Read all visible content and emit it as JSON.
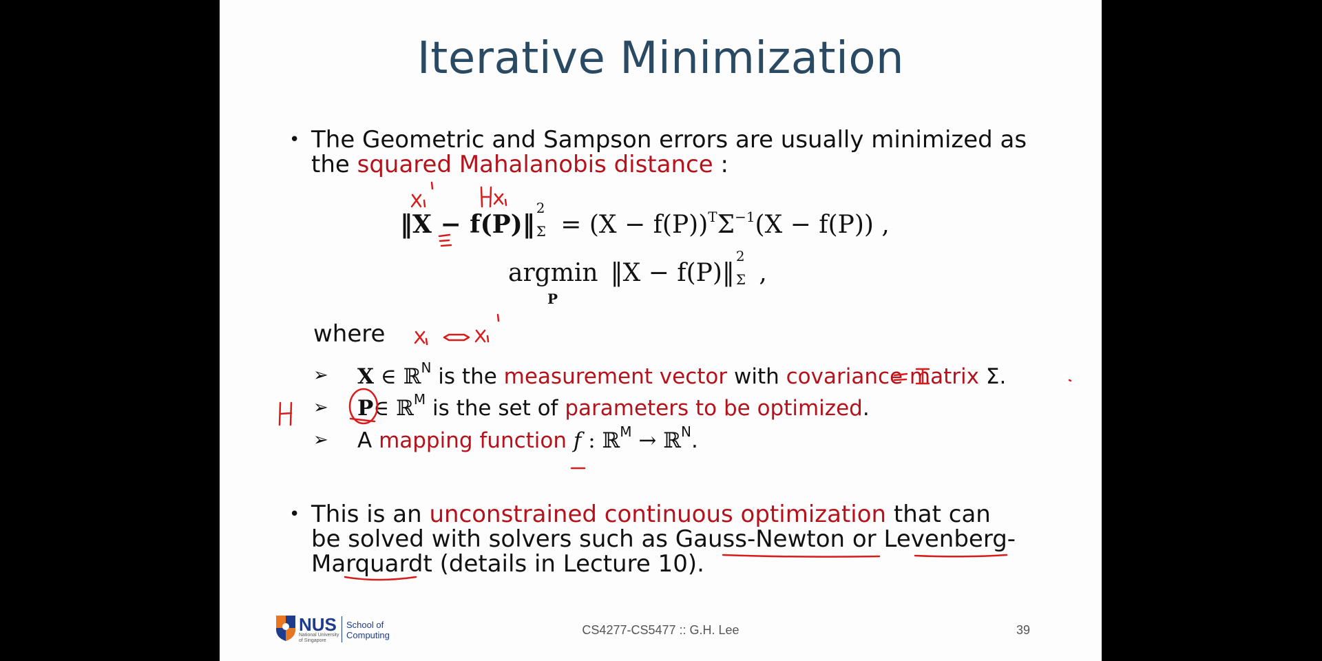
{
  "slide": {
    "title": "Iterative Minimization",
    "bullet1": {
      "line1": "The Geometric and Sampson errors are usually minimized as",
      "line2_prefix": "the ",
      "line2_red": "squared Mahalanobis distance",
      "line2_suffix": " :"
    },
    "equation1": {
      "left": "‖X − f(P)‖",
      "left_sup": "2",
      "left_sub": "Σ",
      "right": "= (X − f(P))",
      "right_sup_T": "T",
      "sigma": "Σ",
      "sigma_sup": "−1",
      "right_tail": "(X − f(P)) ,"
    },
    "equation2": {
      "op": "argmin",
      "op_sub": "P",
      "body": "‖X − f(P)‖",
      "body_sup": "2",
      "body_sub": "Σ",
      "tail": " ,"
    },
    "where_label": "where",
    "items": [
      {
        "symbol": "X",
        "set": " ∈ ℝ",
        "set_sup": "N",
        "text_a": " is the ",
        "red_a": "measurement vector",
        "text_b": " with ",
        "red_b": "covariance matrix",
        "text_c": " Σ."
      },
      {
        "symbol": "P",
        "set": "∈ ℝ",
        "set_sup": "M",
        "text_a": " is the set of ",
        "red_a": "parameters to be optimized",
        "text_b": "."
      },
      {
        "prefix": "A ",
        "red_a": "mapping function",
        "symbol": " f",
        "set": " : ℝ",
        "set_sup": "M",
        "arrow": " → ℝ",
        "arrow_sup": "N",
        "tail": "."
      }
    ],
    "bullet2": {
      "line1_prefix": "This is an ",
      "line1_red": "unconstrained continuous optimization",
      "line1_suffix": " that can",
      "line2": "be solved with solvers such as Gauss-Newton or Levenberg-",
      "line3": "Marquardt (details in Lecture 10)."
    },
    "annotations": {
      "xi_prime": "xᵢ'",
      "hxi": "Hxᵢ",
      "corr": "xᵢ ⇔ xᵢ'",
      "h": "H",
      "eq_identity": "= I"
    },
    "footer": {
      "logo": "NUS",
      "uni_line1": "National University",
      "uni_line2": "of Singapore",
      "school_line1": "School of",
      "school_line2": "Computing",
      "course": "CS4277-CS5477 :: G.H. Lee",
      "page": "39"
    },
    "colors": {
      "title": "#2a4a63",
      "highlight": "#b5121b",
      "ink": "#d81c1c"
    }
  }
}
